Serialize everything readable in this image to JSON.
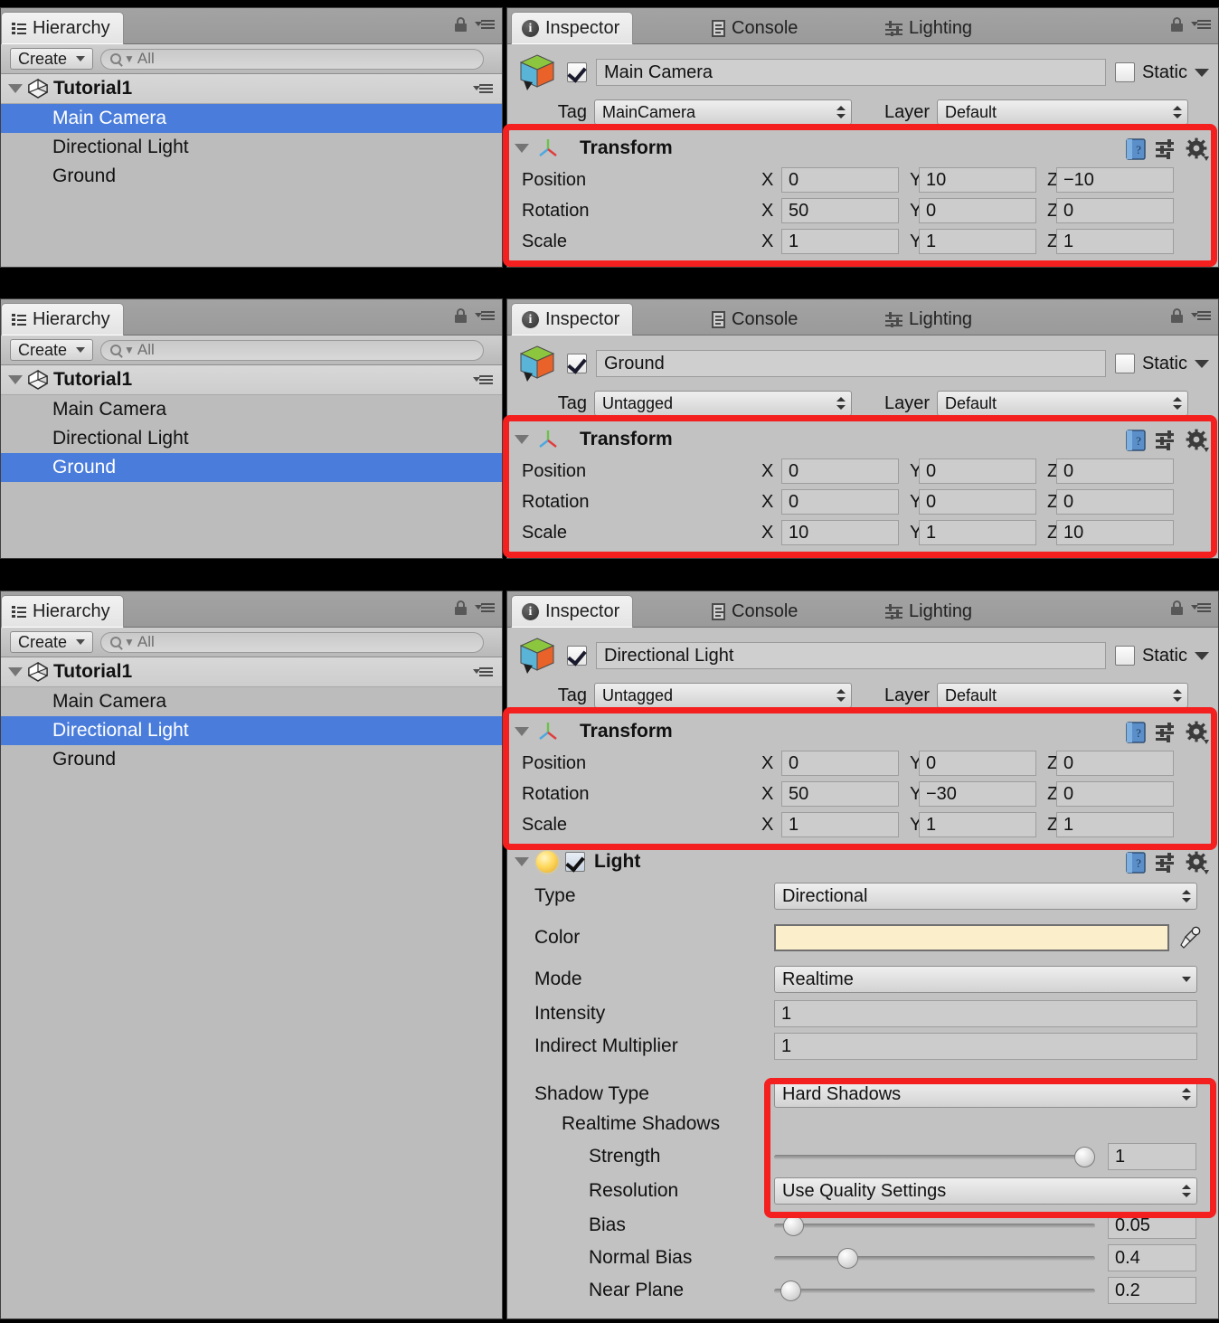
{
  "panels": {
    "hierarchy": {
      "tab_label": "Hierarchy",
      "tab_icon": "hierarchy-icon",
      "create_label": "Create",
      "search_placeholder": "All",
      "search_icon": "search-icon",
      "scene_name": "Tutorial1",
      "lock_icon": "lock-icon",
      "menu_icon": "panel-menu-icon"
    },
    "inspector": {
      "tabs": [
        {
          "label": "Inspector",
          "icon": "info-icon",
          "active": true
        },
        {
          "label": "Console",
          "icon": "console-icon",
          "active": false
        },
        {
          "label": "Lighting",
          "icon": "lighting-icon",
          "active": false
        }
      ],
      "lock_icon": "lock-icon",
      "menu_icon": "panel-menu-icon",
      "static_label": "Static",
      "tag_label": "Tag",
      "layer_label": "Layer",
      "gameobject_icon": "cube-icon"
    }
  },
  "sections": [
    {
      "id": "main-camera",
      "hierarchy_items": [
        {
          "name": "Main Camera",
          "selected": true
        },
        {
          "name": "Directional Light",
          "selected": false
        },
        {
          "name": "Ground",
          "selected": false
        }
      ],
      "gameobject": {
        "name": "Main Camera",
        "enabled": true,
        "static": false,
        "tag": "MainCamera",
        "layer": "Default"
      },
      "transform": {
        "title": "Transform",
        "rows": [
          {
            "label": "Position",
            "x": "0",
            "y": "10",
            "z": "−10"
          },
          {
            "label": "Rotation",
            "x": "50",
            "y": "0",
            "z": "0"
          },
          {
            "label": "Scale",
            "x": "1",
            "y": "1",
            "z": "1"
          }
        ],
        "axes": [
          "X",
          "Y",
          "Z"
        ],
        "highlighted": true
      }
    },
    {
      "id": "ground",
      "hierarchy_items": [
        {
          "name": "Main Camera",
          "selected": false
        },
        {
          "name": "Directional Light",
          "selected": false
        },
        {
          "name": "Ground",
          "selected": true
        }
      ],
      "gameobject": {
        "name": "Ground",
        "enabled": true,
        "static": false,
        "tag": "Untagged",
        "layer": "Default"
      },
      "transform": {
        "title": "Transform",
        "rows": [
          {
            "label": "Position",
            "x": "0",
            "y": "0",
            "z": "0"
          },
          {
            "label": "Rotation",
            "x": "0",
            "y": "0",
            "z": "0"
          },
          {
            "label": "Scale",
            "x": "10",
            "y": "1",
            "z": "10"
          }
        ],
        "axes": [
          "X",
          "Y",
          "Z"
        ],
        "highlighted": true
      }
    },
    {
      "id": "directional-light",
      "hierarchy_items": [
        {
          "name": "Main Camera",
          "selected": false
        },
        {
          "name": "Directional Light",
          "selected": true
        },
        {
          "name": "Ground",
          "selected": false
        }
      ],
      "gameobject": {
        "name": "Directional Light",
        "enabled": true,
        "static": false,
        "tag": "Untagged",
        "layer": "Default"
      },
      "transform": {
        "title": "Transform",
        "rows": [
          {
            "label": "Position",
            "x": "0",
            "y": "0",
            "z": "0"
          },
          {
            "label": "Rotation",
            "x": "50",
            "y": "−30",
            "z": "0"
          },
          {
            "label": "Scale",
            "x": "1",
            "y": "1",
            "z": "1"
          }
        ],
        "axes": [
          "X",
          "Y",
          "Z"
        ],
        "highlighted": true
      },
      "light": {
        "title": "Light",
        "enabled": true,
        "icon": "light-bulb-icon",
        "type_label": "Type",
        "type_value": "Directional",
        "color_label": "Color",
        "color_value": "#faeecb",
        "eyedropper_icon": "eyedropper-icon",
        "mode_label": "Mode",
        "mode_value": "Realtime",
        "intensity_label": "Intensity",
        "intensity_value": "1",
        "indirect_label": "Indirect Multiplier",
        "indirect_value": "1",
        "shadow_type_label": "Shadow Type",
        "shadow_type_value": "Hard Shadows",
        "realtime_shadows_label": "Realtime Shadows",
        "strength_label": "Strength",
        "strength_value": "1",
        "strength_pct": 100,
        "resolution_label": "Resolution",
        "resolution_value": "Use Quality Settings",
        "bias_label": "Bias",
        "bias_value": "0.05",
        "bias_pct": 3,
        "normal_bias_label": "Normal Bias",
        "normal_bias_value": "0.4",
        "normal_bias_pct": 21,
        "near_plane_label": "Near Plane",
        "near_plane_value": "0.2",
        "near_plane_pct": 2
      }
    }
  ],
  "annotation": {
    "highlight_color": "#f41f1f",
    "selection_color": "#4a7ddb"
  }
}
